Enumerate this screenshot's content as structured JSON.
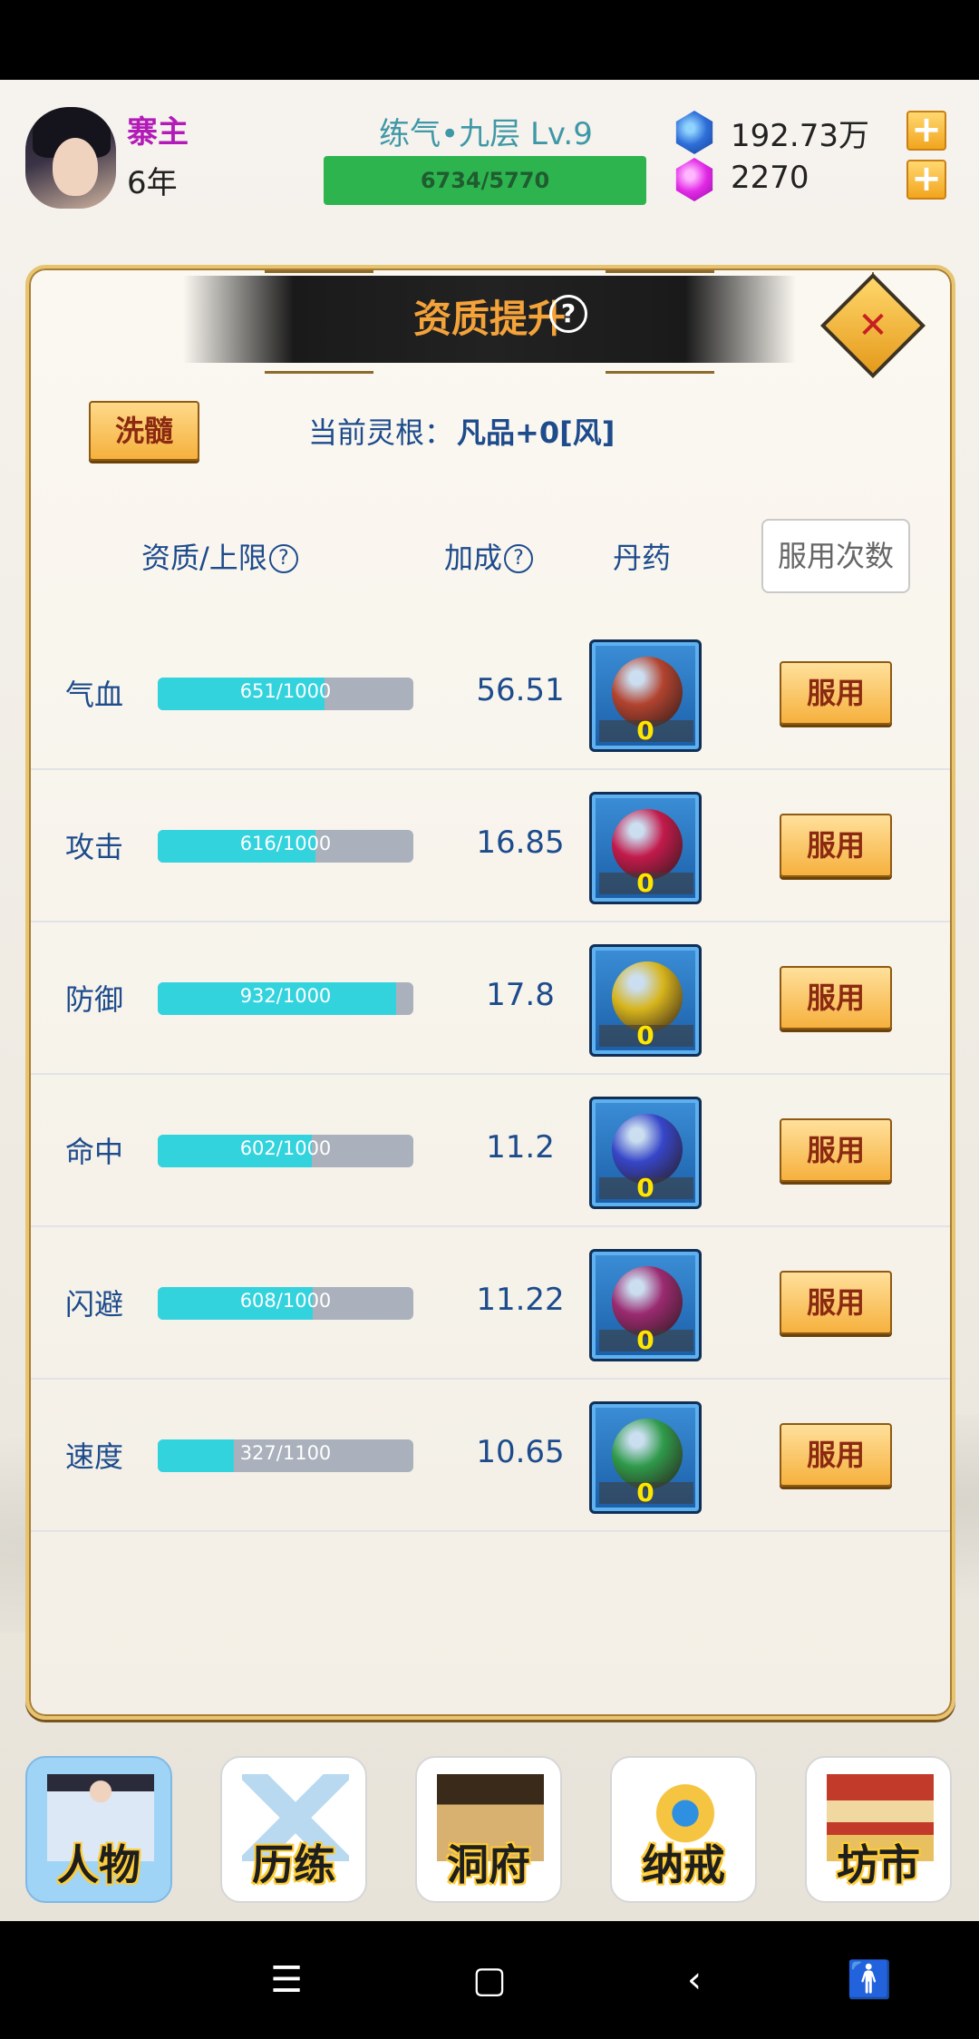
{
  "player": {
    "name": "寨主",
    "age": "6年",
    "realm": "练气•九层 Lv.9",
    "exp": "6734/5770"
  },
  "resources": {
    "spirit_stones": "192.73万",
    "gems": "2270"
  },
  "panel": {
    "title": "资质提升",
    "help": "?",
    "close": "✕",
    "wash_button": "洗髓",
    "root_label": "当前灵根：",
    "root_value": "凡品+0[风]"
  },
  "columns": {
    "aptitude": "资质/上限",
    "bonus": "加成",
    "pill": "丹药",
    "use_times": "服用次数"
  },
  "rows": [
    {
      "name": "气血",
      "progress": "651/1000",
      "value": 651,
      "max": 1000,
      "bonus": "56.51",
      "pill_count": "0",
      "pill_color": "#b2432f",
      "use": "服用"
    },
    {
      "name": "攻击",
      "progress": "616/1000",
      "value": 616,
      "max": 1000,
      "bonus": "16.85",
      "pill_count": "0",
      "pill_color": "#c21a4b",
      "use": "服用"
    },
    {
      "name": "防御",
      "progress": "932/1000",
      "value": 932,
      "max": 1000,
      "bonus": "17.8",
      "pill_count": "0",
      "pill_color": "#d6b41c",
      "use": "服用"
    },
    {
      "name": "命中",
      "progress": "602/1000",
      "value": 602,
      "max": 1000,
      "bonus": "11.2",
      "pill_count": "0",
      "pill_color": "#3646c8",
      "use": "服用"
    },
    {
      "name": "闪避",
      "progress": "608/1000",
      "value": 608,
      "max": 1000,
      "bonus": "11.22",
      "pill_count": "0",
      "pill_color": "#9a2a70",
      "use": "服用"
    },
    {
      "name": "速度",
      "progress": "327/1100",
      "value": 327,
      "max": 1100,
      "bonus": "10.65",
      "pill_count": "0",
      "pill_color": "#2f9a4a",
      "use": "服用"
    }
  ],
  "nav": [
    {
      "label": "人物",
      "icon": "character-icon",
      "active": true
    },
    {
      "label": "历练",
      "icon": "crossed-swords-icon",
      "active": false
    },
    {
      "label": "洞府",
      "icon": "cave-dwelling-icon",
      "active": false
    },
    {
      "label": "纳戒",
      "icon": "storage-ring-icon",
      "active": false
    },
    {
      "label": "坊市",
      "icon": "market-pagoda-icon",
      "active": false
    }
  ],
  "system_nav": {
    "menu": "☰",
    "home": "▢",
    "back": "‹",
    "accessibility": "🚹"
  },
  "colors": {
    "accent_gold": "#f4a23a",
    "bar_fill": "#33d3de",
    "exp_green": "#2db44e",
    "name_purple": "#b21bb7"
  }
}
